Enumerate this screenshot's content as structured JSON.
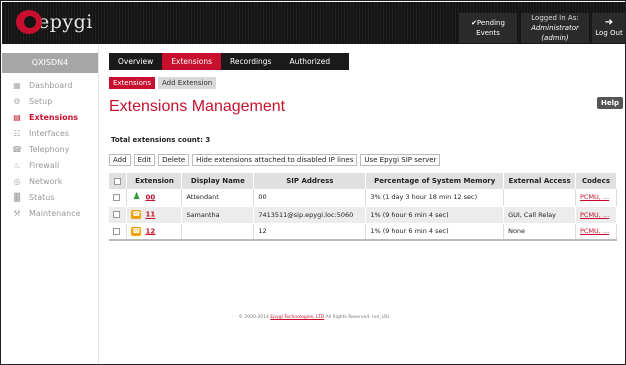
{
  "header": {
    "logo_text": "epygi",
    "pending_events": "✔Pending Events",
    "logged_in_label": "Logged In As:",
    "logged_in_user": "Administrator (admin)",
    "logout_label": "Log Out"
  },
  "sidebar": {
    "system_name": "QXISDN4",
    "items": [
      {
        "label": "Dashboard",
        "icon": "dashboard-icon"
      },
      {
        "label": "Setup",
        "icon": "gear-icon"
      },
      {
        "label": "Extensions",
        "icon": "extensions-icon"
      },
      {
        "label": "Interfaces",
        "icon": "interfaces-icon"
      },
      {
        "label": "Telephony",
        "icon": "phone-icon"
      },
      {
        "label": "Firewall",
        "icon": "firewall-icon"
      },
      {
        "label": "Network",
        "icon": "network-icon"
      },
      {
        "label": "Status",
        "icon": "status-icon"
      },
      {
        "label": "Maintenance",
        "icon": "wrench-icon"
      }
    ],
    "active_index": 2
  },
  "tabs": [
    "Overview",
    "Extensions",
    "Recordings",
    "Authorized Phones"
  ],
  "active_tab": 1,
  "subtabs": [
    "Extensions",
    "Add Extension"
  ],
  "page_title": "Extensions Management",
  "help_label": "Help",
  "count_text": "Total extensions count: 3",
  "actions": [
    "Add",
    "Edit",
    "Delete",
    "Hide extensions attached to disabled IP lines",
    "Use Epygi SIP server"
  ],
  "table": {
    "columns": [
      "",
      "Extension",
      "Display Name",
      "SIP Address",
      "Percentage of System Memory",
      "External Access",
      "Codecs"
    ],
    "rows": [
      {
        "icon": "user",
        "extension": "00",
        "display_name": "Attendant",
        "sip": "00",
        "memory": "3% (1 day 3 hour 18 min 12 sec)",
        "external": "",
        "codecs": "PCMU, ..."
      },
      {
        "icon": "phone",
        "extension": "11",
        "display_name": "Samantha",
        "sip": "7413511@sip.epygi.loc:5060",
        "memory": "1% (9 hour 6 min 4 sec)",
        "external": "GUI, Call Relay",
        "codecs": "PCMU, ..."
      },
      {
        "icon": "phone",
        "extension": "12",
        "display_name": "",
        "sip": "12",
        "memory": "1% (9 hour 6 min 4 sec)",
        "external": "None",
        "codecs": "PCMU, ..."
      }
    ]
  },
  "footer": {
    "prefix": "© 2000-2014",
    "company": "Epygi Technologies, LTD",
    "suffix": "All Rights Reserved. (en_US)"
  },
  "colors": {
    "accent": "#c8102e",
    "header_bg": "#141414"
  }
}
